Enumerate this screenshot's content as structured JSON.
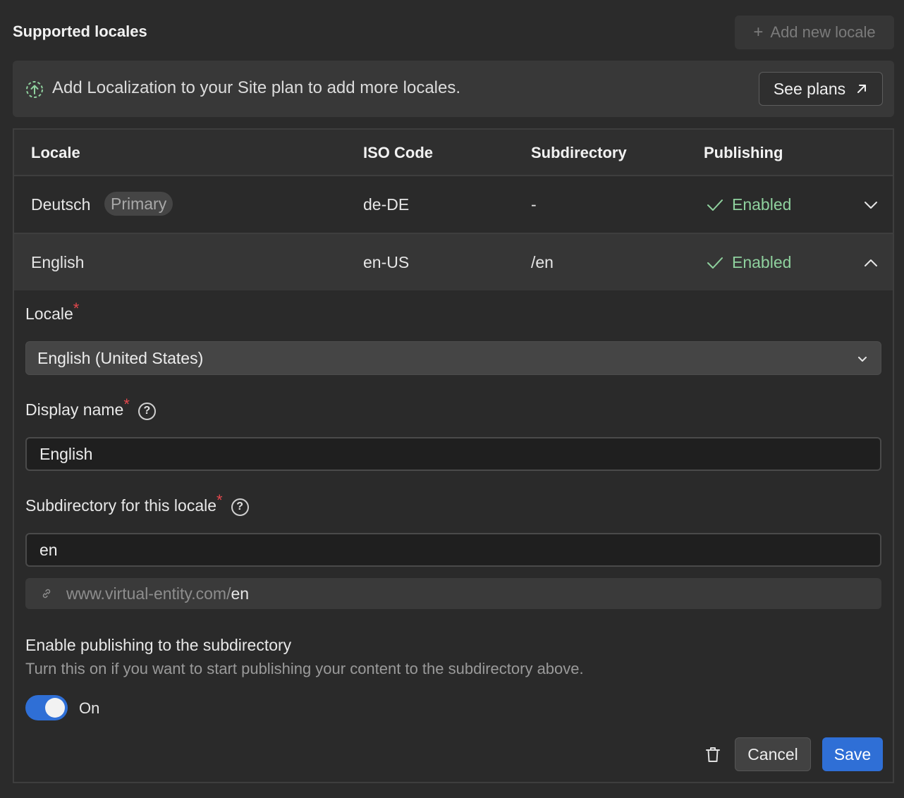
{
  "header": {
    "title": "Supported locales",
    "add_button": "Add new locale",
    "add_icon": "plus-icon"
  },
  "banner": {
    "icon": "upgrade-arrow-icon",
    "text": "Add Localization to your Site plan to add more locales.",
    "see_plans": "See plans"
  },
  "table": {
    "columns": [
      "Locale",
      "ISO Code",
      "Subdirectory",
      "Publishing"
    ],
    "rows": [
      {
        "locale": "Deutsch",
        "badge": "Primary",
        "iso": "de-DE",
        "subdirectory": "-",
        "publishing": "Enabled",
        "expanded": false
      },
      {
        "locale": "English",
        "badge": "",
        "iso": "en-US",
        "subdirectory": "/en",
        "publishing": "Enabled",
        "expanded": true
      }
    ]
  },
  "form": {
    "locale_label": "Locale",
    "locale_value": "English (United States)",
    "display_name_label": "Display name",
    "display_name_value": "English",
    "subdirectory_label": "Subdirectory for this locale",
    "subdirectory_value": "en",
    "url_prefix": "www.virtual-entity.com/",
    "url_suffix": "en",
    "required_marker": "*",
    "help_glyph": "?",
    "publishing_title": "Enable publishing to the subdirectory",
    "publishing_desc": "Turn this on if you want to start publishing your content to the subdirectory above.",
    "toggle_state": "On",
    "cancel": "Cancel",
    "save": "Save"
  },
  "colors": {
    "accent": "#2f6fd6",
    "enabled": "#8fd19e",
    "required": "#e5484d",
    "background": "#2b2b2b"
  }
}
